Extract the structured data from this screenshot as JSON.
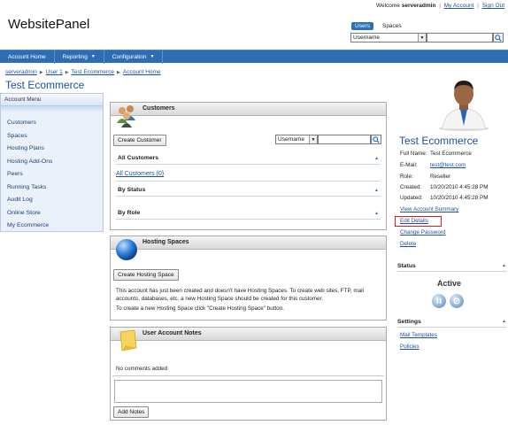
{
  "header": {
    "welcome_text": "Welcome",
    "username": "serveradmin",
    "my_account": "My Account",
    "sign_out": "Sign Out",
    "logo": "WebsitePanel",
    "scope_tabs": [
      "Users",
      "Spaces"
    ],
    "search_select": "Username",
    "search_value": ""
  },
  "nav": [
    {
      "label": "Account Home",
      "has_menu": false
    },
    {
      "label": "Reporting",
      "has_menu": true
    },
    {
      "label": "Configuration",
      "has_menu": true
    }
  ],
  "breadcrumb": [
    "serveradmin",
    "User 1",
    "Test Ecommerce",
    "Account Home"
  ],
  "page_title": "Test Ecommerce",
  "account_menu": {
    "title": "Account Menu",
    "items": [
      "Customers",
      "Spaces",
      "Hosting Plans",
      "Hosting Add-Ons",
      "Peers",
      "Running Tasks",
      "Audit Log",
      "Online Store",
      "My Ecommerce"
    ]
  },
  "customers": {
    "title": "Customers",
    "create_button": "Create Customer",
    "search_select": "Username",
    "search_value": "",
    "all_customers_heading": "All Customers",
    "all_customers_link": "All Customers (0)",
    "by_status": "By Status",
    "by_role": "By Role"
  },
  "hosting_spaces": {
    "title": "Hosting Spaces",
    "create_button": "Create Hosting Space",
    "message1": "This account has just been created and doesn't have Hosting Spaces. To create web sites, FTP, mail accounts, databases, etc. a new Hosting Space should be created for this customer.",
    "message2": "To create a new Hosting Space click \"Create Hosting Space\" button."
  },
  "notes": {
    "title": "User Account Notes",
    "empty_text": "No comments added",
    "textarea_value": "",
    "add_button": "Add Notes"
  },
  "profile": {
    "name": "Test Ecommerce",
    "fields": [
      {
        "label": "Full Name:",
        "value": "Test Ecommerce",
        "is_link": false
      },
      {
        "label": "E-Mail:",
        "value": "test@test.com",
        "is_link": true
      },
      {
        "label": "Role:",
        "value": "Reseller",
        "is_link": false
      },
      {
        "label": "Created:",
        "value": "10/20/2010 4:45:28 PM",
        "is_link": false
      },
      {
        "label": "Updated:",
        "value": "10/20/2010 4:45:28 PM",
        "is_link": false
      }
    ],
    "links": [
      "View Account Summary",
      "Edit Details",
      "Change Password",
      "Delete"
    ]
  },
  "status": {
    "heading": "Status",
    "value": "Active"
  },
  "settings": {
    "heading": "Settings",
    "links": [
      "Mail Templates",
      "Policies"
    ]
  },
  "colors": {
    "nav_blue": "#2e6db4",
    "link_blue": "#1f4f9a",
    "highlight_red": "#d52020"
  }
}
